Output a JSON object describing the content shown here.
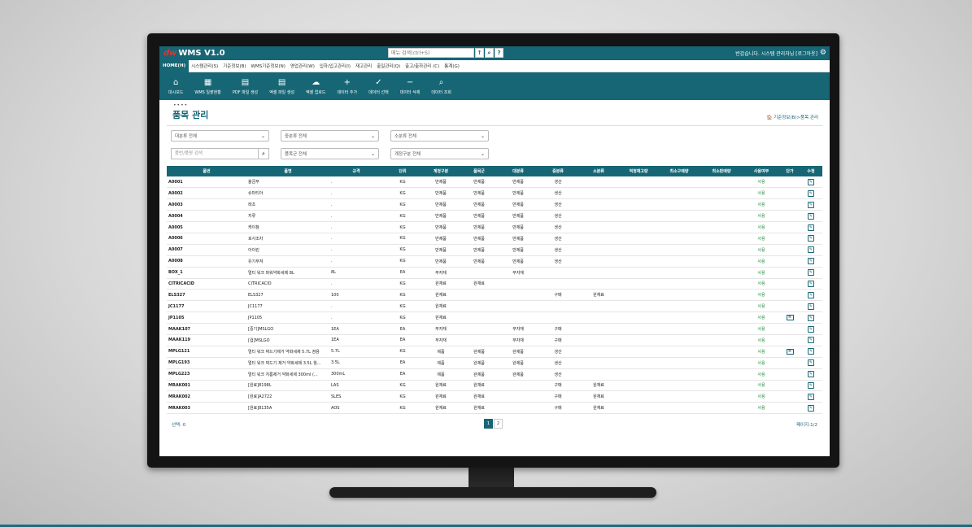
{
  "app": {
    "logo_mark": "dw",
    "title": "WMS V1.0"
  },
  "top_search": {
    "placeholder": "메뉴 검색(ctrl+S)",
    "up_glyph": "↑",
    "search_glyph": "⌕",
    "help_glyph": "?"
  },
  "greeting": "반갑습니다. 시스템 관리자님 [로그아웃]",
  "menu": [
    "HOME(H)",
    "시스템관리(S)",
    "기준정보(B)",
    "WMS기준정보(N)",
    "영업관리(W)",
    "입하/입고관리(I)",
    "재고관리",
    "출일관리(Q)",
    "출고/출하관리 (C)",
    "통계(G)"
  ],
  "toolbar": [
    {
      "icon": "home-icon",
      "glyph": "⌂",
      "label": "대시보드"
    },
    {
      "icon": "calendar-icon",
      "glyph": "▦",
      "label": "WMS 일괄현황"
    },
    {
      "icon": "pdf-icon",
      "glyph": "▤",
      "label": "PDF 파일 생성"
    },
    {
      "icon": "excel-icon",
      "glyph": "▤",
      "label": "엑셀 파일 생성"
    },
    {
      "icon": "cloud-upload-icon",
      "glyph": "☁",
      "label": "엑셀 업로드"
    },
    {
      "icon": "plus-icon",
      "glyph": "+",
      "label": "데이터 추가"
    },
    {
      "icon": "check-icon",
      "glyph": "✓",
      "label": "데이터 선택"
    },
    {
      "icon": "minus-icon",
      "glyph": "−",
      "label": "데이터 삭제"
    },
    {
      "icon": "search-icon",
      "glyph": "⌕",
      "label": "데이터 조회"
    }
  ],
  "page": {
    "dots": "••••",
    "title": "품목 관리",
    "breadcrumb": "🏠 기준정보(B)>품목 관리"
  },
  "filters": {
    "row1": [
      "대분류 전체",
      "중분류 전체",
      "소분류 전체"
    ],
    "search_placeholder": "품번/품명 검색",
    "row2": [
      "품목군 전체",
      "계정구분 전체"
    ]
  },
  "table": {
    "headers": [
      "품번",
      "품명",
      "규격",
      "단위",
      "계정구분",
      "품목군",
      "대분류",
      "중분류",
      "소분류",
      "적정재고량",
      "최소구매량",
      "최소판매량",
      "사용여부",
      "단가",
      "수정"
    ],
    "rows": [
      [
        "A0001",
        "율금무",
        ".",
        "KG",
        "반제품",
        "반제품",
        "반제품",
        "생산",
        "",
        "",
        "",
        "",
        "사용",
        "",
        "✎"
      ],
      [
        "A0002",
        "슈마티아",
        ".",
        "KG",
        "반제품",
        "반제품",
        "반제품",
        "생산",
        "",
        "",
        "",
        "",
        "사용",
        "",
        "✎"
      ],
      [
        "A0003",
        "레조",
        ".",
        "KG",
        "반제품",
        "반제품",
        "반제품",
        "생산",
        "",
        "",
        "",
        "",
        "사용",
        "",
        "✎"
      ],
      [
        "A0004",
        "지류",
        ".",
        "KG",
        "반제품",
        "반제품",
        "반제품",
        "생산",
        "",
        "",
        "",
        "",
        "사용",
        "",
        "✎"
      ],
      [
        "A0005",
        "캐이참",
        ".",
        "KG",
        "반제품",
        "반제품",
        "반제품",
        "생산",
        "",
        "",
        "",
        "",
        "사용",
        "",
        "✎"
      ],
      [
        "A0006",
        "호사조차",
        ".",
        "KG",
        "반제품",
        "반제품",
        "반제품",
        "생산",
        "",
        "",
        "",
        "",
        "사용",
        "",
        "✎"
      ],
      [
        "A0007",
        "아이린",
        ".",
        "KG",
        "반제품",
        "반제품",
        "반제품",
        "생산",
        "",
        "",
        "",
        "",
        "사용",
        "",
        "✎"
      ],
      [
        "A0008",
        "유기부져",
        ".",
        "KG",
        "반제품",
        "반제품",
        "반제품",
        "생산",
        "",
        "",
        "",
        "",
        "사용",
        "",
        "✎"
      ],
      [
        "BOX_1",
        "멀티 워크 파워약화세제 8L",
        "8L",
        "EA",
        "부자재",
        "",
        "부자재",
        "",
        "",
        "",
        "",
        "",
        "사용",
        "",
        "✎"
      ],
      [
        "CITRICACID",
        "CITRICACID",
        ".",
        "KG",
        "원재료",
        "원재료",
        "",
        "",
        "",
        "",
        "",
        "",
        "사용",
        "",
        "✎"
      ],
      [
        "ELS327",
        "ELS327",
        "100",
        "KG",
        "원재료",
        "",
        "",
        "구매",
        "원재료",
        "",
        "",
        "",
        "사용",
        "",
        "✎"
      ],
      [
        "JC1177",
        "JC1177",
        ".",
        "KG",
        "원재료",
        "",
        "",
        "",
        "",
        "",
        "",
        "",
        "사용",
        "",
        "✎"
      ],
      [
        "JP1105",
        "JP1105",
        ".",
        "KG",
        "원재료",
        "",
        "",
        "",
        "",
        "",
        "",
        "",
        "사용",
        "≣",
        "✎"
      ],
      [
        "MAAK107",
        "[중기]MSLGO",
        "1EA",
        "EA",
        "부자재",
        "",
        "부자재",
        "구매",
        "",
        "",
        "",
        "",
        "사용",
        "",
        "✎"
      ],
      [
        "MAAK119",
        "[컵]MSLGO",
        "1EA",
        "EA",
        "부자재",
        "",
        "부자재",
        "구매",
        "",
        "",
        "",
        "",
        "사용",
        "",
        "✎"
      ],
      [
        "MPLG121",
        "멀티 워크 찌드기제거 약화세제 5.7L 겸용",
        "5.7L",
        "KG",
        "제품",
        "완제품",
        "완제품",
        "생산",
        "",
        "",
        "",
        "",
        "사용",
        "≣",
        "✎"
      ],
      [
        "MPLG193",
        "멀티 워크 찌드기 제거 약화세제 3.5L 월...",
        "3.5L",
        "EA",
        "제품",
        "완제품",
        "완제품",
        "생산",
        "",
        "",
        "",
        "",
        "사용",
        "",
        "✎"
      ],
      [
        "MPLG223",
        "멀티 워크 지름제거 약화세제 300ml (...",
        "300mL",
        "EA",
        "제품",
        "완제품",
        "완제품",
        "생산",
        "",
        "",
        "",
        "",
        "사용",
        "",
        "✎"
      ],
      [
        "MRAK001",
        "[원료]8198L",
        "LAS",
        "KG",
        "원재료",
        "원재료",
        "",
        "구매",
        "원재료",
        "",
        "",
        "",
        "사용",
        "",
        "✎"
      ],
      [
        "MRAK002",
        "[원료]A2722",
        "SLES",
        "KG",
        "원재료",
        "원재료",
        "",
        "구매",
        "원재료",
        "",
        "",
        "",
        "사용",
        "",
        "✎"
      ],
      [
        "MRAK003",
        "[원료]8135A",
        "AOS",
        "KG",
        "원재료",
        "원재료",
        "",
        "구매",
        "원재료",
        "",
        "",
        "",
        "사용",
        "",
        "✎"
      ]
    ]
  },
  "footer": {
    "selected": "선택: 0",
    "pages": [
      "1",
      "2"
    ],
    "active_page": 0,
    "page_info": "페이지:1/2"
  }
}
